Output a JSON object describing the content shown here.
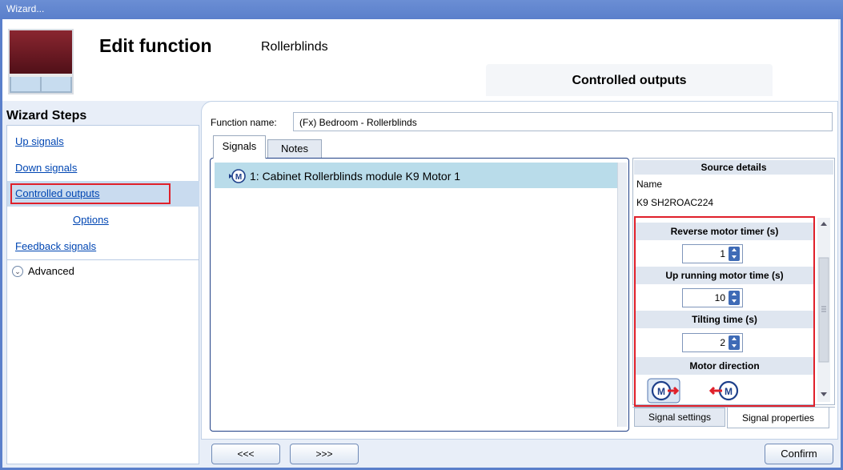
{
  "window": {
    "title": "Wizard..."
  },
  "header": {
    "title": "Edit function",
    "subtitle": "Rollerblinds",
    "active_tab": "Controlled outputs"
  },
  "wizard_steps": {
    "heading": "Wizard Steps",
    "items": [
      "Up signals",
      "Down signals",
      "Controlled outputs",
      "Options",
      "Feedback signals"
    ],
    "selected": "Controlled outputs",
    "advanced": "Advanced"
  },
  "function_name": {
    "label": "Function name:",
    "value": "(Fx) Bedroom - Rollerblinds"
  },
  "tabs": [
    "Signals",
    "Notes"
  ],
  "signals_list": [
    {
      "icon": "motor-icon",
      "text": "1: Cabinet Rollerblinds module K9 Motor 1"
    }
  ],
  "source_details": {
    "heading": "Source details",
    "name_label": "Name",
    "name_value": "K9 SH2ROAC224"
  },
  "signal_properties": {
    "reverse_motor_timer": {
      "label": "Reverse motor timer (s)",
      "value": "1"
    },
    "up_running_motor_time": {
      "label": "Up running motor time (s)",
      "value": "10"
    },
    "tilting_time": {
      "label": "Tilting time (s)",
      "value": "2"
    },
    "motor_direction": {
      "label": "Motor direction",
      "options": [
        "motor-forward-icon",
        "motor-reverse-icon"
      ],
      "selected": "motor-forward-icon"
    }
  },
  "right_tabs": [
    "Signal settings",
    "Signal properties"
  ],
  "footer": {
    "prev": "<<<",
    "next": ">>>",
    "confirm": "Confirm"
  },
  "colors": {
    "accent": "#5a7fcb",
    "highlight": "#e0202a",
    "selected_row": "#b9dcea"
  }
}
